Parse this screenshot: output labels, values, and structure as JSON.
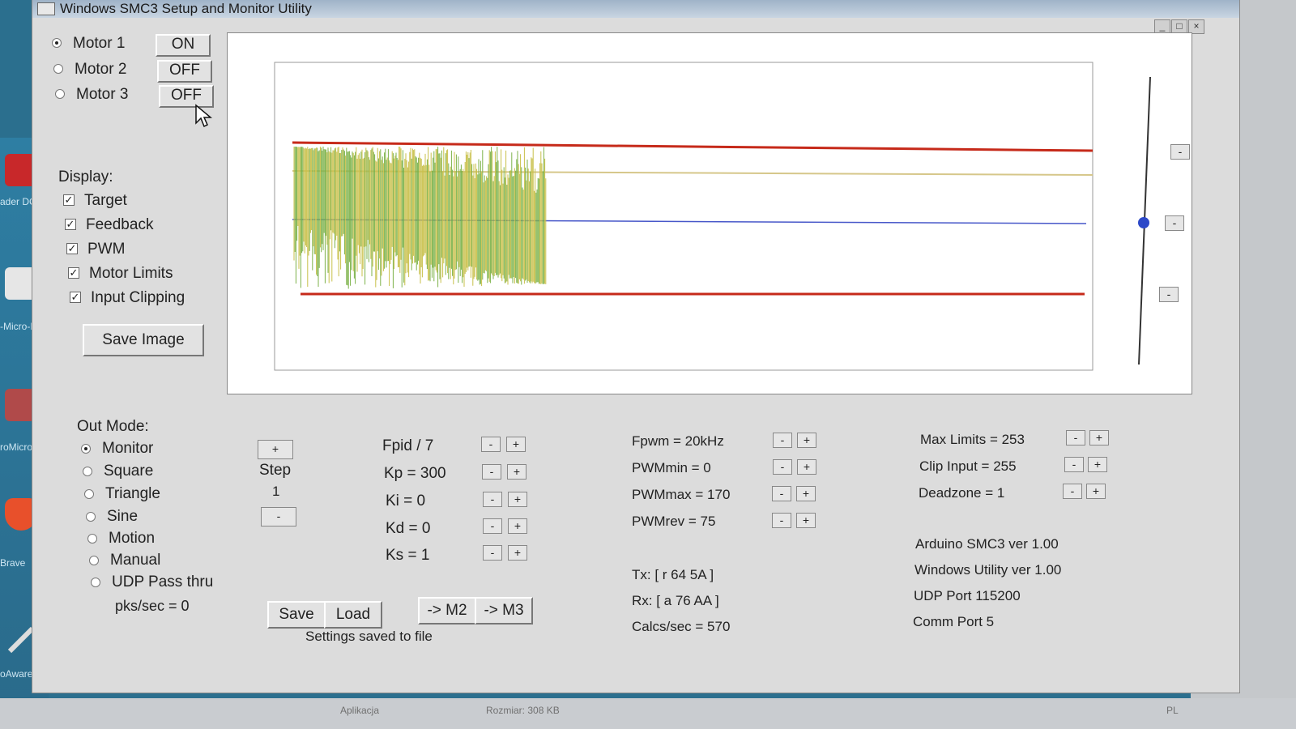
{
  "desktop": {
    "icons": [
      {
        "name": "app-icon-reader",
        "label": "ader DC",
        "color": "#c8282a"
      },
      {
        "name": "app-icon-micro",
        "label": "-Micro-B",
        "color": "#e0e0e0"
      },
      {
        "name": "app-icon-promicro",
        "label": "roMicroPin",
        "color": "#b04a4a"
      },
      {
        "name": "brave-icon",
        "label": "Brave",
        "color": "#e8502b"
      },
      {
        "name": "pen-icon",
        "label": "oAwaree Free",
        "color": "#d9d9d9"
      }
    ],
    "taskbar": {
      "item1": "Aplikacja",
      "item2": "Rozmiar: 308 KB",
      "lang": "PL"
    }
  },
  "window": {
    "title": "Windows SMC3 Setup and Monitor Utility",
    "controls": {
      "minimize": "_",
      "maximize": "□",
      "close": "×"
    }
  },
  "motors": [
    {
      "label": "Motor 1",
      "state": "ON",
      "selected": true
    },
    {
      "label": "Motor 2",
      "state": "OFF",
      "selected": false
    },
    {
      "label": "Motor 3",
      "state": "OFF",
      "selected": false
    }
  ],
  "display": {
    "heading": "Display:",
    "options": [
      {
        "label": "Target",
        "checked": true
      },
      {
        "label": "Feedback",
        "checked": true
      },
      {
        "label": "PWM",
        "checked": true
      },
      {
        "label": "Motor Limits",
        "checked": true
      },
      {
        "label": "Input Clipping",
        "checked": true
      }
    ],
    "save_image": "Save Image"
  },
  "graph": {
    "colors": {
      "limits": "#c62a1a",
      "target": "#4757c9",
      "feedback": "#c8c04a",
      "pwm": "#7db24a",
      "clip": "#d6c78a"
    }
  },
  "side_buttons": {
    "b1": "-",
    "b2": "-",
    "b3": "-"
  },
  "out_mode": {
    "heading": "Out Mode:",
    "options": [
      {
        "label": "Monitor",
        "selected": true
      },
      {
        "label": "Square",
        "selected": false
      },
      {
        "label": "Triangle",
        "selected": false
      },
      {
        "label": "Sine",
        "selected": false
      },
      {
        "label": "Motion",
        "selected": false
      },
      {
        "label": "Manual",
        "selected": false
      },
      {
        "label": "UDP Pass thru",
        "selected": false
      }
    ],
    "pks": "pks/sec = 0"
  },
  "step": {
    "plus": "+",
    "label": "Step",
    "value": "1",
    "minus": "-"
  },
  "pid": {
    "items": [
      "Fpid / 7",
      "Kp = 300",
      "Ki = 0",
      "Kd = 0",
      "Ks = 1"
    ],
    "minus": "-",
    "plus": "+"
  },
  "pwm": {
    "items": [
      "Fpwm = 20kHz",
      "PWMmin = 0",
      "PWMmax = 170",
      "PWMrev = 75"
    ],
    "minus": "-",
    "plus": "+"
  },
  "limits": {
    "items": [
      "Max Limits = 253",
      "Clip Input = 255",
      "Deadzone = 1"
    ],
    "minus": "-",
    "plus": "+"
  },
  "buttons": {
    "save": "Save",
    "load": "Load",
    "to_m2": "-> M2",
    "to_m3": "-> M3"
  },
  "status": {
    "saved": "Settings saved to file",
    "tx": "Tx: [ r 64 5A ]",
    "rx": "Rx: [ a 76 AA ]",
    "calcs": "Calcs/sec = 570"
  },
  "info": {
    "arduino": "Arduino SMC3 ver 1.00",
    "utility": "Windows Utility ver 1.00",
    "udp": "UDP Port 115200",
    "comm": "Comm Port 5"
  }
}
